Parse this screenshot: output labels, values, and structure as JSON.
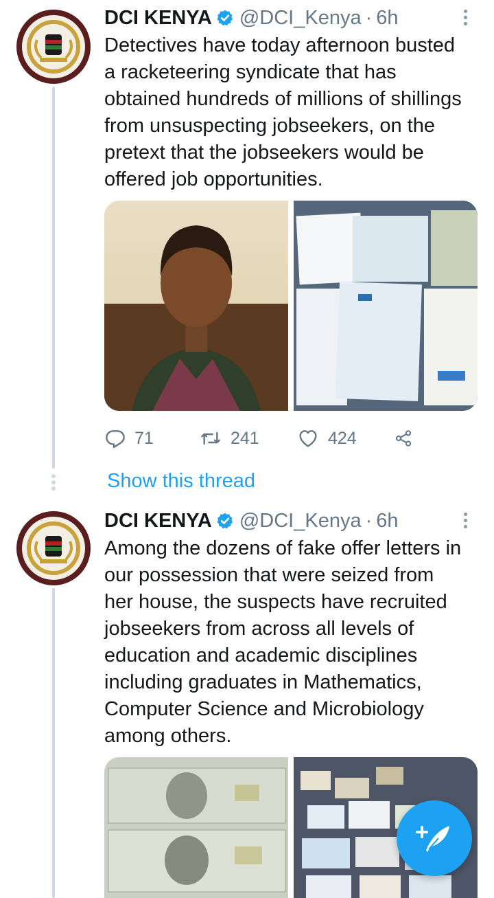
{
  "tweets": [
    {
      "name": "DCI KENYA",
      "handle": "@DCI_Kenya",
      "time": "6h",
      "lines": [
        "Detectives have today afternoon busted",
        "a racketeering syndicate that has",
        "obtained hundreds of millions of shillings",
        "from unsuspecting jobseekers, on the",
        "pretext that the jobseekers would be",
        "offered job opportunities."
      ],
      "replies": "71",
      "retweets": "241",
      "likes": "424"
    },
    {
      "name": "DCI KENYA",
      "handle": "@DCI_Kenya",
      "time": "6h",
      "lines": [
        "Among the dozens of fake offer letters in",
        "our possession that were seized from",
        "her house, the suspects have recruited",
        "jobseekers from across all levels of",
        "education and academic disciplines",
        "including graduates in Mathematics,",
        "Computer Science and Microbiology",
        "among others."
      ]
    }
  ],
  "show_thread": "Show this thread",
  "separator": "·",
  "icons": {
    "verified": "verified-badge-icon",
    "more": "more-vertical-icon",
    "reply": "reply-icon",
    "retweet": "retweet-icon",
    "like": "heart-icon",
    "share": "share-icon",
    "compose": "compose-tweet-icon"
  },
  "colors": {
    "accent": "#1da1f2",
    "text": "#14171a",
    "secondary": "#657786",
    "thread_line": "#cfd9de"
  }
}
